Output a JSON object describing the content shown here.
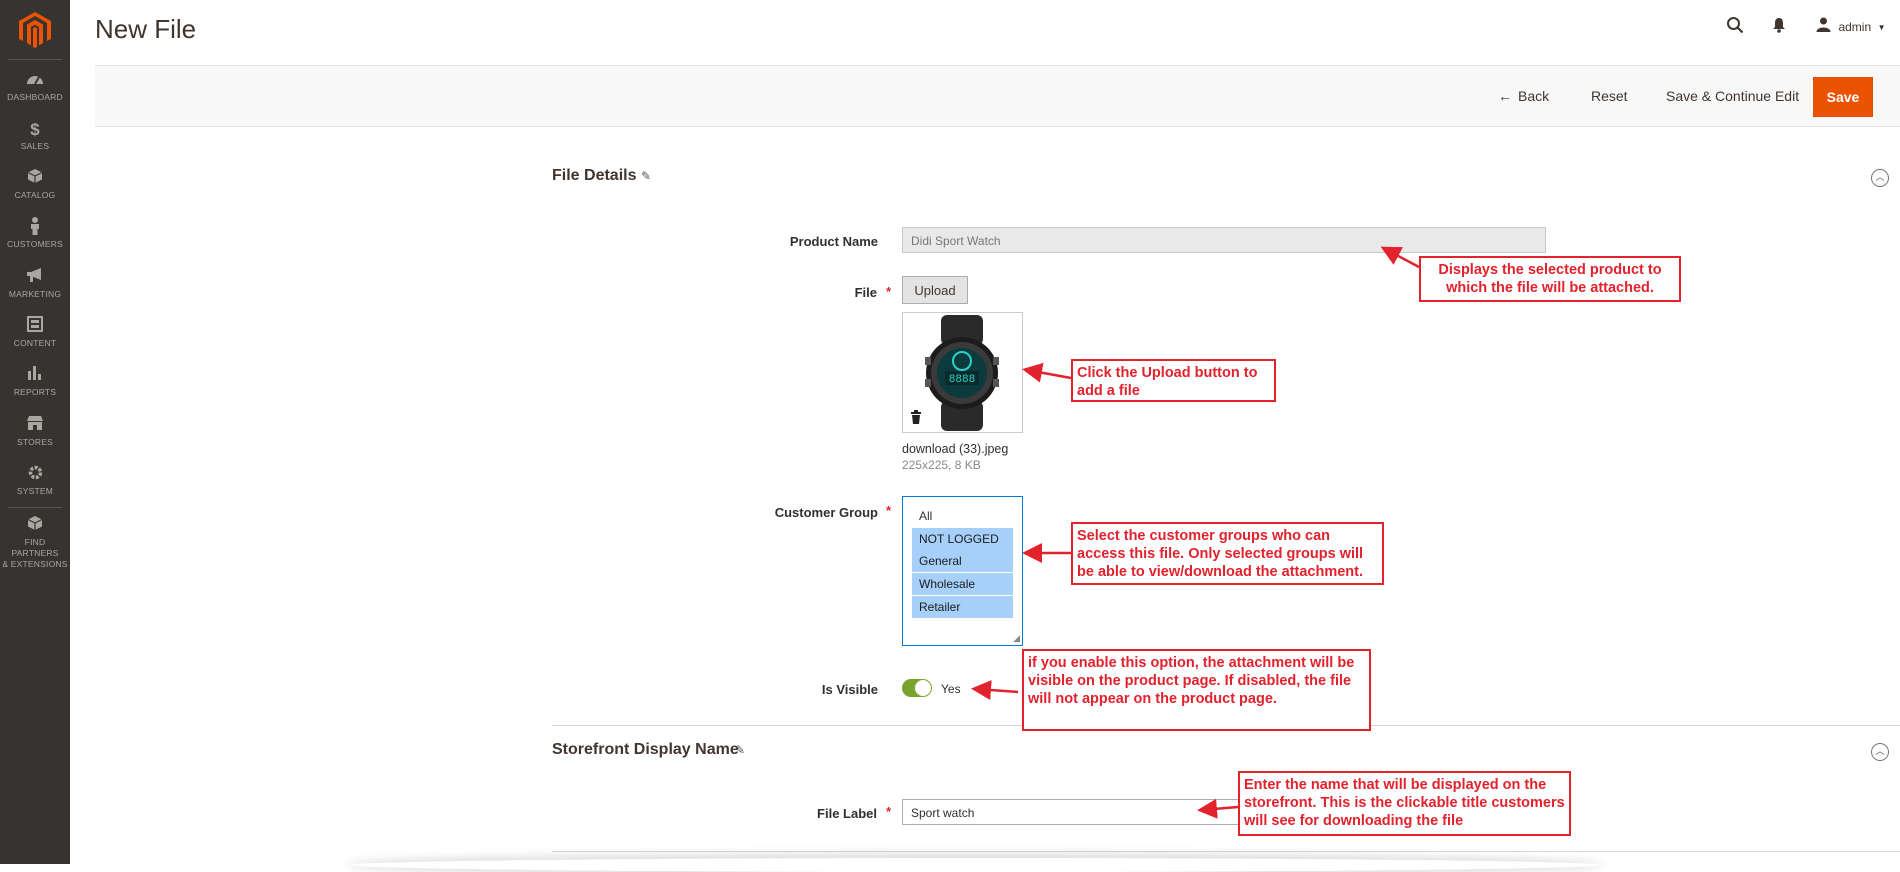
{
  "sidebar": {
    "items": [
      {
        "label": "Dashboard",
        "icon": "dashboard-icon"
      },
      {
        "label": "Sales",
        "icon": "dollar-icon"
      },
      {
        "label": "Catalog",
        "icon": "box-icon"
      },
      {
        "label": "Customers",
        "icon": "person-icon"
      },
      {
        "label": "Marketing",
        "icon": "megaphone-icon"
      },
      {
        "label": "Content",
        "icon": "layout-icon"
      },
      {
        "label": "Reports",
        "icon": "bar-chart-icon"
      },
      {
        "label": "Stores",
        "icon": "store-icon"
      },
      {
        "label": "System",
        "icon": "gear-icon"
      },
      {
        "label_line1": "Find Partners",
        "label_line2": "& Extensions",
        "icon": "partners-box-icon"
      }
    ]
  },
  "header": {
    "title": "New File",
    "user": "admin"
  },
  "actions": {
    "back": "Back",
    "reset": "Reset",
    "save_continue": "Save & Continue Edit",
    "save": "Save"
  },
  "file_details": {
    "title": "File Details",
    "product_name_label": "Product Name",
    "product_name_value": "Didi Sport Watch",
    "file_label": "File",
    "upload_label": "Upload",
    "file_name": "download (33).jpeg",
    "file_meta": "225x225, 8 KB",
    "customer_group_label": "Customer Group",
    "customer_group_options": [
      "All",
      "NOT LOGGED IN",
      "General",
      "Wholesale",
      "Retailer"
    ],
    "is_visible_label": "Is Visible",
    "is_visible_value": "Yes"
  },
  "storefront": {
    "title": "Storefront Display Name",
    "file_label_label": "File Label",
    "file_label_value": "Sport watch"
  },
  "callouts": {
    "product": "Displays the selected product to which the file will be attached.",
    "upload": "Click the Upload button to add a file",
    "groups": "Select the customer groups who can access this file. Only selected groups will be able to view/download the attachment.",
    "visible": "if you enable this option, the attachment will be visible on the product page. If disabled, the file will not appear on the product page.",
    "label": "Enter the name that will be displayed on the storefront. This is the clickable title customers will see for downloading the file"
  },
  "colors": {
    "sidebar_bg": "#373330",
    "accent": "#eb5202",
    "callout": "#e2222c",
    "selected_option": "#a6d0fa",
    "toggle_on": "#79a22e"
  }
}
